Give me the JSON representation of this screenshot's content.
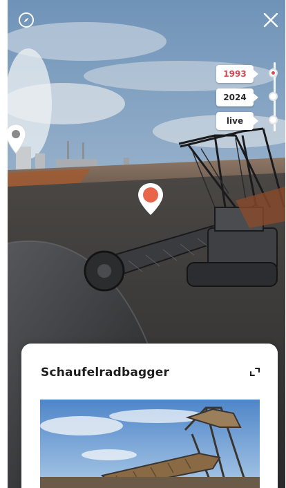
{
  "toolbar": {
    "compass_icon": "compass-icon",
    "close_icon": "close-icon"
  },
  "timeline": {
    "items": [
      {
        "label": "1993",
        "active": true
      },
      {
        "label": "2024",
        "active": false
      },
      {
        "label": "live",
        "active": false
      }
    ],
    "active_color": "#d64a52"
  },
  "hotspots": {
    "main_pin_icon": "map-pin-icon",
    "main_pin_color": "#e8644a",
    "edge_pin_icon": "map-pin-icon",
    "edge_pin_color": "#ffffff"
  },
  "info_card": {
    "title": "Schaufelradbagger",
    "expand_icon": "expand-icon"
  }
}
